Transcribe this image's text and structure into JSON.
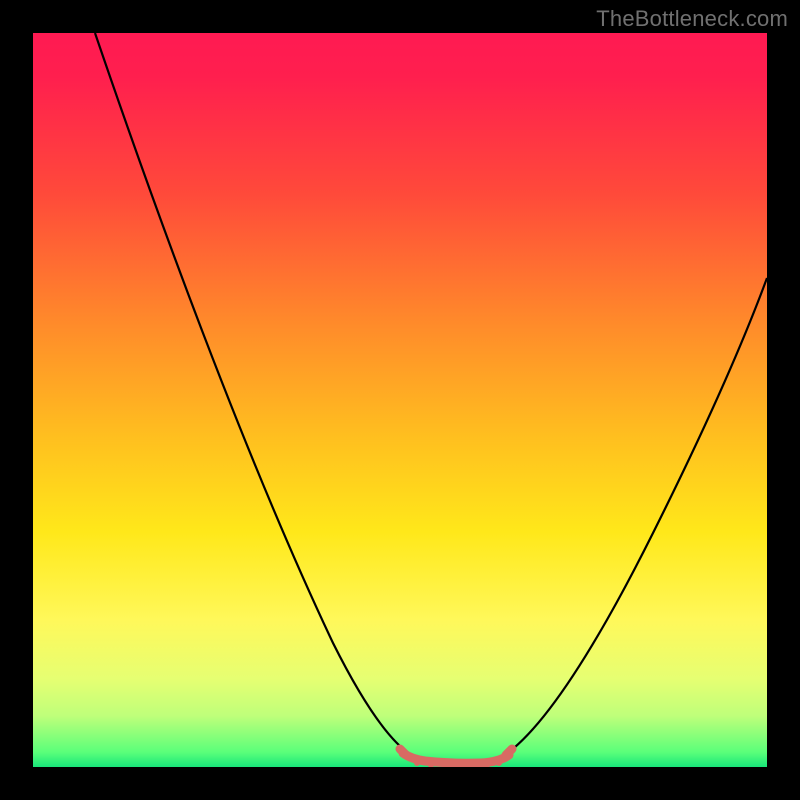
{
  "watermark": "TheBottleneck.com",
  "colors": {
    "page_bg": "#000000",
    "watermark": "#707070",
    "curve": "#000000",
    "highlight": "#d86a63",
    "gradient_top": "#ff1a52",
    "gradient_bottom": "#19e67a"
  },
  "chart_data": {
    "type": "line",
    "title": "",
    "xlabel": "",
    "ylabel": "",
    "xlim": [
      0,
      100
    ],
    "ylim": [
      0,
      100
    ],
    "grid": false,
    "note": "Values estimated from pixels; x is horizontal position (0=left edge of plot, 100=right), y is curve height (0=bottom, 100=top).",
    "series": [
      {
        "name": "Left curve",
        "x": [
          8.5,
          12,
          16,
          20,
          24,
          28,
          32,
          36,
          40,
          44,
          47,
          49,
          51
        ],
        "values": [
          100,
          90,
          80,
          70,
          60,
          50,
          40,
          30,
          21,
          12,
          6,
          3,
          1.2
        ]
      },
      {
        "name": "Right curve",
        "x": [
          64,
          67,
          70,
          74,
          78,
          82,
          86,
          90,
          94,
          98,
          100
        ],
        "values": [
          1.2,
          3,
          6,
          12,
          20,
          28,
          37,
          46,
          55,
          63,
          67
        ]
      },
      {
        "name": "Highlighted minimum band",
        "x": [
          50,
          52,
          54,
          56,
          58,
          60,
          62,
          64,
          65
        ],
        "values": [
          1.6,
          1.0,
          0.7,
          0.6,
          0.6,
          0.7,
          0.9,
          1.3,
          1.8
        ]
      }
    ]
  }
}
